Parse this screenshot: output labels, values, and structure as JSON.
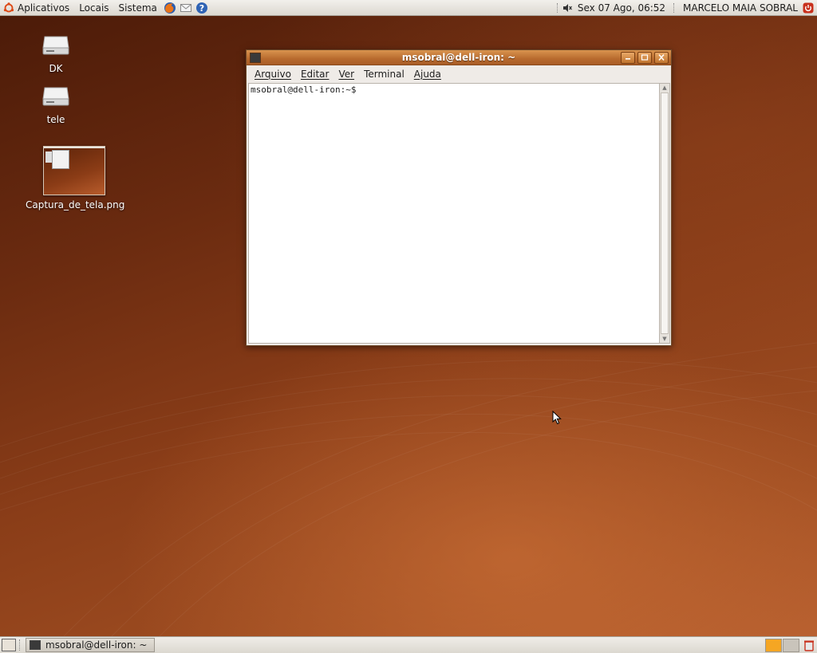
{
  "top_panel": {
    "menu": [
      "Aplicativos",
      "Locais",
      "Sistema"
    ],
    "launchers": [
      "firefox-icon",
      "mail-icon",
      "help-icon"
    ],
    "clock": "Sex 07 Ago, 06:52",
    "user": "MARCELO MAIA SOBRAL"
  },
  "desktop": {
    "icons": [
      {
        "label": "DK",
        "icon": "drive-icon"
      },
      {
        "label": "tele",
        "icon": "drive-icon"
      },
      {
        "label": "Captura_de_tela.png",
        "icon": "image-thumbnail"
      }
    ]
  },
  "terminal": {
    "title": "msobral@dell-iron: ~",
    "menu": [
      "Arquivo",
      "Editar",
      "Ver",
      "Terminal",
      "Ajuda"
    ],
    "prompt": "msobral@dell-iron:~$ "
  },
  "bottom_panel": {
    "task": "msobral@dell-iron: ~"
  },
  "colors": {
    "titlebar": "#b86a2e",
    "workspace_active": "#f5a623"
  }
}
